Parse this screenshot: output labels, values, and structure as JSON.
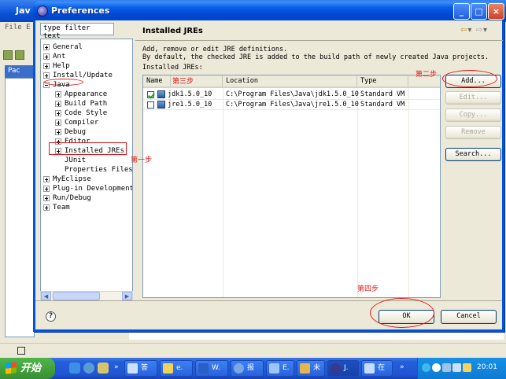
{
  "background_window": {
    "title": "Jav",
    "menu": "File E",
    "tab": "Pac"
  },
  "dialog": {
    "title": "Preferences",
    "filter_value": "type filter text",
    "tree": [
      {
        "label": "General",
        "expander": "plus",
        "level": 0
      },
      {
        "label": "Ant",
        "expander": "plus",
        "level": 0
      },
      {
        "label": "Help",
        "expander": "plus",
        "level": 0
      },
      {
        "label": "Install/Update",
        "expander": "plus",
        "level": 0
      },
      {
        "label": "Java",
        "expander": "minus",
        "level": 0
      },
      {
        "label": "Appearance",
        "expander": "plus",
        "level": 1
      },
      {
        "label": "Build Path",
        "expander": "plus",
        "level": 1
      },
      {
        "label": "Code Style",
        "expander": "plus",
        "level": 1
      },
      {
        "label": "Compiler",
        "expander": "plus",
        "level": 1
      },
      {
        "label": "Debug",
        "expander": "plus",
        "level": 1
      },
      {
        "label": "Editor",
        "expander": "plus",
        "level": 1
      },
      {
        "label": "Installed JREs",
        "expander": "plus",
        "level": 1
      },
      {
        "label": "JUnit",
        "expander": "none",
        "level": 1
      },
      {
        "label": "Properties Files",
        "expander": "none",
        "level": 1
      },
      {
        "label": "MyEclipse",
        "expander": "plus",
        "level": 0
      },
      {
        "label": "Plug-in Development",
        "expander": "plus",
        "level": 0
      },
      {
        "label": "Run/Debug",
        "expander": "plus",
        "level": 0
      },
      {
        "label": "Team",
        "expander": "plus",
        "level": 0
      }
    ],
    "page": {
      "title": "Installed JREs",
      "description_line1": "Add, remove or edit JRE definitions.",
      "description_line2": "By default, the checked JRE is added to the build path of newly created Java projects.",
      "installed_label": "Installed JREs:",
      "columns": [
        "Name",
        "Location",
        "Type"
      ],
      "rows": [
        {
          "checked": true,
          "name": "jdk1.5.0_10",
          "location": "C:\\Program Files\\Java\\jdk1.5.0_10",
          "type": "Standard VM"
        },
        {
          "checked": false,
          "name": "jre1.5.0_10",
          "location": "C:\\Program Files\\Java\\jre1.5.0_10",
          "type": "Standard VM"
        }
      ],
      "buttons": {
        "add": "Add...",
        "edit": "Edit...",
        "copy": "Copy...",
        "remove": "Remove",
        "search": "Search..."
      }
    },
    "footer": {
      "help": "?",
      "ok": "OK",
      "cancel": "Cancel"
    }
  },
  "annotations": {
    "step1": "第一步",
    "step2": "第二步",
    "step3": "第三步",
    "step4": "第四步",
    "color": "#e1181a"
  },
  "taskbar": {
    "start": "开始",
    "tasks": [
      "答",
      "e.",
      "W.",
      "报",
      "E.",
      "未",
      "J.",
      "在"
    ],
    "clock": "20:01"
  }
}
